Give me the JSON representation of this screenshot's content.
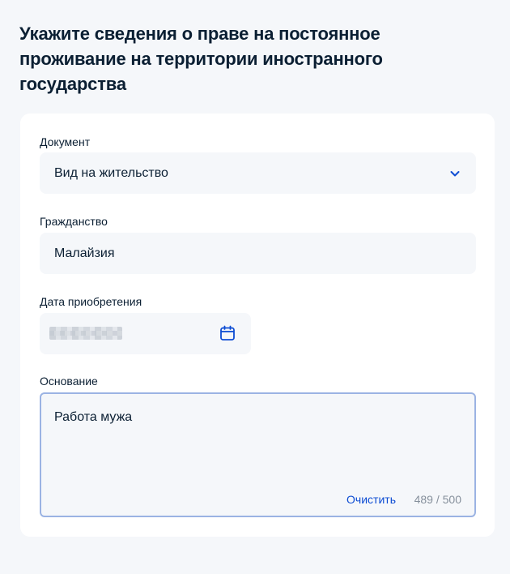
{
  "page": {
    "title": "Укажите сведения о праве на постоянное проживание на территории иностранного государства"
  },
  "form": {
    "document": {
      "label": "Документ",
      "value": "Вид на жительство",
      "icon": "chevron-down-icon"
    },
    "citizenship": {
      "label": "Гражданство",
      "value": "Малайзия"
    },
    "acquisition_date": {
      "label": "Дата приобретения",
      "value_redacted": true,
      "icon": "calendar-icon"
    },
    "basis": {
      "label": "Основание",
      "value": "Работа мужа",
      "clear_label": "Очистить",
      "counter": "489 / 500"
    }
  },
  "colors": {
    "background": "#f5f7fa",
    "card": "#ffffff",
    "text": "#0b1f33",
    "accent": "#0d4cd3",
    "muted": "#86909c",
    "focus_border": "#9bb3e3"
  }
}
